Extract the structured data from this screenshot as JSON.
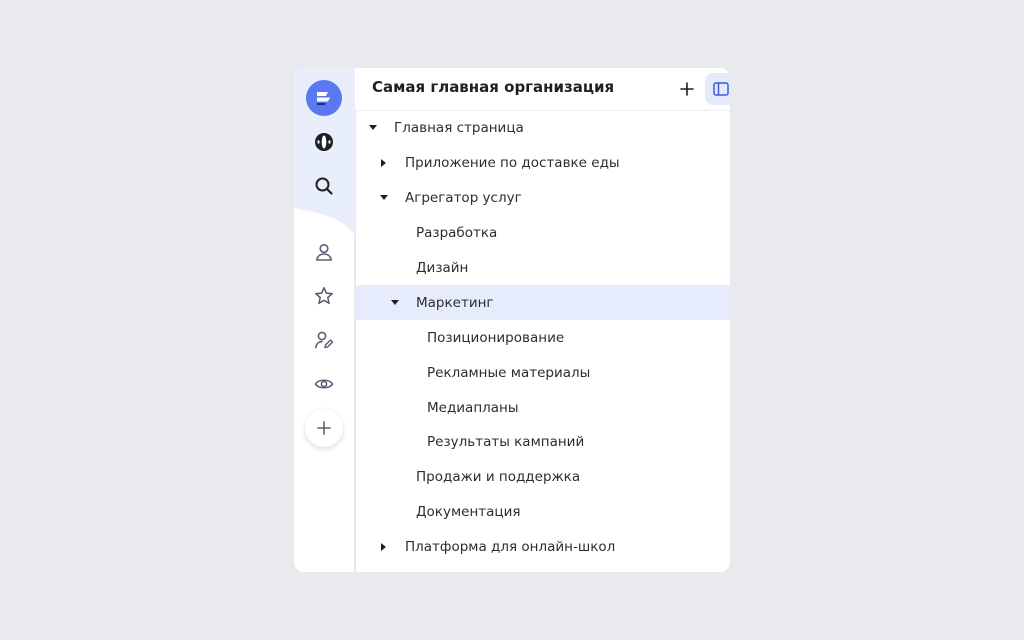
{
  "header": {
    "org_title": "Самая главная организация"
  },
  "rail": {
    "icons": [
      "logo-icon",
      "spaces-icon",
      "search-icon",
      "user-icon",
      "star-icon",
      "user-edit-icon",
      "eye-icon",
      "plus-icon"
    ]
  },
  "tree": [
    {
      "label": "Главная страница",
      "level": 0,
      "caret": "down"
    },
    {
      "label": "Приложение по доставке еды",
      "level": 1,
      "caret": "right"
    },
    {
      "label": "Агрегатор услуг",
      "level": 1,
      "caret": "down"
    },
    {
      "label": "Разработка",
      "level": 2,
      "caret": "none"
    },
    {
      "label": "Дизайн",
      "level": 2,
      "caret": "none"
    },
    {
      "label": "Маркетинг",
      "level": 2,
      "caret": "down",
      "selected": true
    },
    {
      "label": "Позиционирование",
      "level": 3,
      "caret": "none"
    },
    {
      "label": "Рекламные материалы",
      "level": 3,
      "caret": "none"
    },
    {
      "label": "Медиапланы",
      "level": 3,
      "caret": "none"
    },
    {
      "label": "Результаты кампаний",
      "level": 3,
      "caret": "none"
    },
    {
      "label": "Продажи и поддержка",
      "level": 2,
      "caret": "none"
    },
    {
      "label": "Документация",
      "level": 2,
      "caret": "none"
    },
    {
      "label": "Платформа для онлайн-школ",
      "level": 1,
      "caret": "right"
    }
  ],
  "colors": {
    "accent": "#5a79f0",
    "selected_bg": "#e6ecfb",
    "rail_top_bg": "#e9eefb",
    "background": "#e8eaee"
  }
}
